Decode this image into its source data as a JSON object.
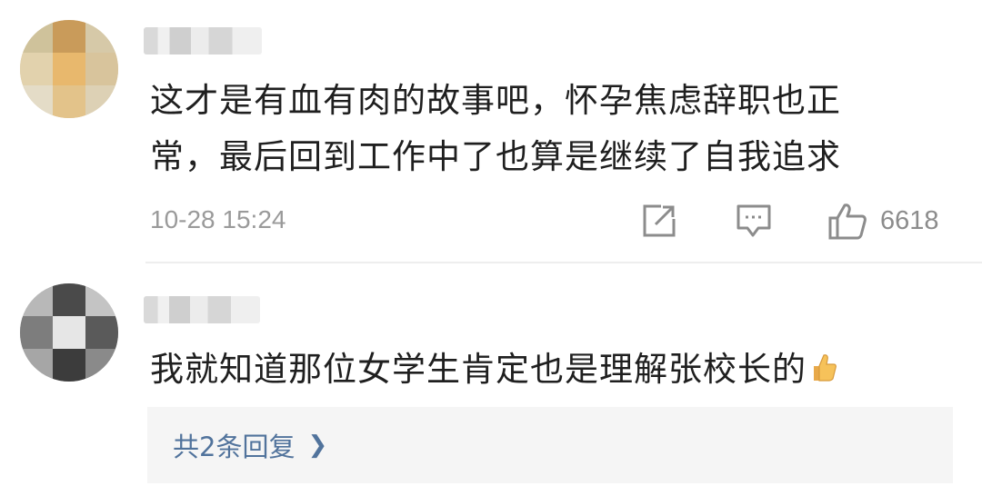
{
  "comments": [
    {
      "text_line1": "这才是有血有肉的故事吧，怀孕焦虑辞职也正",
      "text_line2": "常，最后回到工作中了也算是继续了自我追求",
      "timestamp": "10-28 15:24",
      "likes": "6618",
      "icons": [
        "share-icon",
        "comment-icon",
        "like-icon"
      ]
    },
    {
      "text": "我就知道那位女学生肯定也是理解张校长的",
      "emoji": "thumbs-up-emoji",
      "replies_label": "共2条回复"
    }
  ],
  "colors": {
    "reply_link": "#51739c",
    "meta_text": "#9a9a9a"
  }
}
